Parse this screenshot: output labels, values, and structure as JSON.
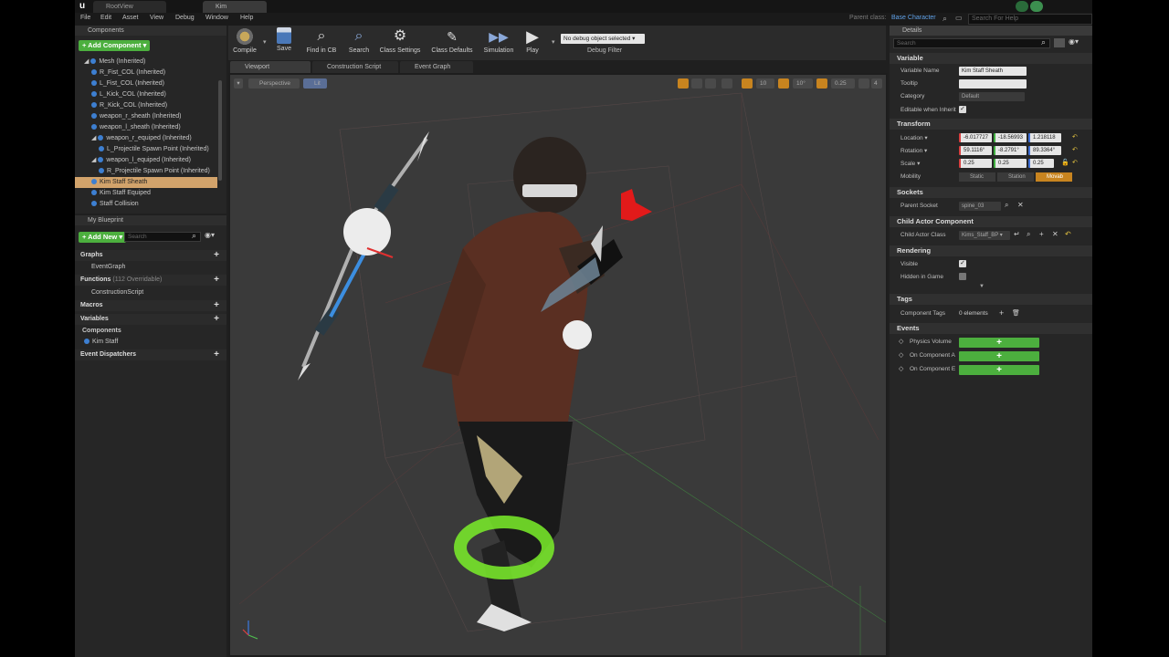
{
  "window": {
    "tabs": [
      "RootView",
      "Kim"
    ],
    "parent_class_label": "Parent class:",
    "parent_class_value": "Base Character",
    "search_placeholder": "Search For Help"
  },
  "menu": [
    "File",
    "Edit",
    "Asset",
    "View",
    "Debug",
    "Window",
    "Help"
  ],
  "components": {
    "title": "Components",
    "add_label": "+ Add Component ▾",
    "items": [
      {
        "label": "Mesh (Inherited)",
        "indent": 0
      },
      {
        "label": "R_Fist_COL (Inherited)",
        "indent": 1
      },
      {
        "label": "L_Fist_COL (Inherited)",
        "indent": 1
      },
      {
        "label": "L_Kick_COL (Inherited)",
        "indent": 1
      },
      {
        "label": "R_Kick_COL (Inherited)",
        "indent": 1
      },
      {
        "label": "weapon_r_sheath (Inherited)",
        "indent": 1
      },
      {
        "label": "weapon_l_sheath (Inherited)",
        "indent": 1
      },
      {
        "label": "weapon_r_equiped (Inherited)",
        "indent": 1
      },
      {
        "label": "L_Projectile Spawn Point (Inherited)",
        "indent": 2
      },
      {
        "label": "weapon_l_equiped (Inherited)",
        "indent": 1
      },
      {
        "label": "R_Projectile Spawn Point (Inherited)",
        "indent": 2
      },
      {
        "label": "Kim Staff Sheath",
        "indent": 1,
        "selected": true
      },
      {
        "label": "Kim Staff Equiped",
        "indent": 1
      },
      {
        "label": "Staff Collision",
        "indent": 1
      }
    ]
  },
  "blueprint": {
    "title": "My Blueprint",
    "add_new": "+ Add New ▾",
    "search_placeholder": "Search",
    "graphs": "Graphs",
    "event_graph": "EventGraph",
    "functions": "Functions",
    "functions_note": "(112 Overridable)",
    "construction_script": "ConstructionScript",
    "macros": "Macros",
    "variables": "Variables",
    "components": "Components",
    "kim_staff": "Kim Staff",
    "event_dispatchers": "Event Dispatchers"
  },
  "toolbar": {
    "compile": "Compile",
    "save": "Save",
    "find": "Find in CB",
    "search": "Search",
    "class_settings": "Class Settings",
    "class_defaults": "Class Defaults",
    "simulation": "Simulation",
    "play": "Play",
    "debug_object": "No debug object selected ▾",
    "debug_filter": "Debug Filter"
  },
  "viewport": {
    "tabs": [
      "Viewport",
      "Construction Script",
      "Event Graph"
    ],
    "perspective": "Perspective",
    "lit": "Lit",
    "grid_snap": "10",
    "rot_snap": "10°",
    "scale_snap": "0.25",
    "camera_speed": "4"
  },
  "details": {
    "title": "Details",
    "search_placeholder": "Search",
    "variable": {
      "header": "Variable",
      "name_label": "Variable Name",
      "name_value": "Kim Staff Sheath",
      "tooltip_label": "Tooltip",
      "category_label": "Category",
      "category_value": "Default",
      "editable_label": "Editable when Inherit"
    },
    "transform": {
      "header": "Transform",
      "location_label": "Location ▾",
      "location": [
        "-6.017727",
        "-18.56993",
        "1.218118"
      ],
      "rotation_label": "Rotation ▾",
      "rotation": [
        "59.1116°",
        "-8.2791°",
        "89.3364°"
      ],
      "scale_label": "Scale ▾",
      "scale": [
        "0.25",
        "0.25",
        "0.25"
      ],
      "mobility_label": "Mobility",
      "mobility": [
        "Static",
        "Station",
        "Movab"
      ]
    },
    "sockets": {
      "header": "Sockets",
      "parent_label": "Parent Socket",
      "parent_value": "spine_03"
    },
    "child_actor": {
      "header": "Child Actor Component",
      "class_label": "Child Actor Class",
      "class_value": "Kims_Staff_BP ▾"
    },
    "rendering": {
      "header": "Rendering",
      "visible": "Visible",
      "hidden": "Hidden in Game"
    },
    "tags": {
      "header": "Tags",
      "component_tags": "Component Tags",
      "count": "0 elements"
    },
    "events": {
      "header": "Events",
      "items": [
        "Physics Volume",
        "On Component A",
        "On Component E"
      ]
    }
  }
}
